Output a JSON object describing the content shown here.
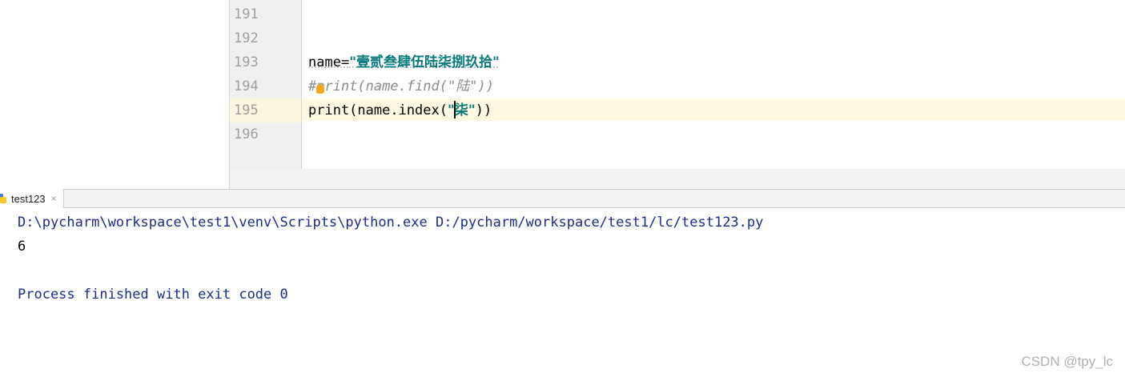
{
  "editor": {
    "line_numbers": [
      "191",
      "192",
      "193",
      "194",
      "195",
      "196"
    ],
    "line193": {
      "ident": "name=",
      "string": "\"壹贰叁肆伍陆柒捌玖拾\""
    },
    "line194": {
      "comment_hash": "#",
      "comment_text": "print(name.find(\"陆\"))"
    },
    "line195": {
      "prefix": "print(name.index(",
      "string_open": "\"",
      "string_rest": "柒\"",
      "suffix": "))"
    },
    "current_line": "195",
    "colors": {
      "string": "#087b7b",
      "comment": "#8c8c8c",
      "current_line_bg": "#fdf9e3",
      "gutter_bg": "#f0f0f0"
    }
  },
  "run_panel": {
    "tab_label": "test123",
    "tab_close": "×",
    "console": {
      "command": "D:\\pycharm\\workspace\\test1\\venv\\Scripts\\python.exe D:/pycharm/workspace/test1/lc/test123.py",
      "output": "6",
      "exit_message": "Process finished with exit code 0"
    },
    "colors": {
      "console_text": "#1a2d8c"
    }
  },
  "watermark": "CSDN @tpy_lc"
}
